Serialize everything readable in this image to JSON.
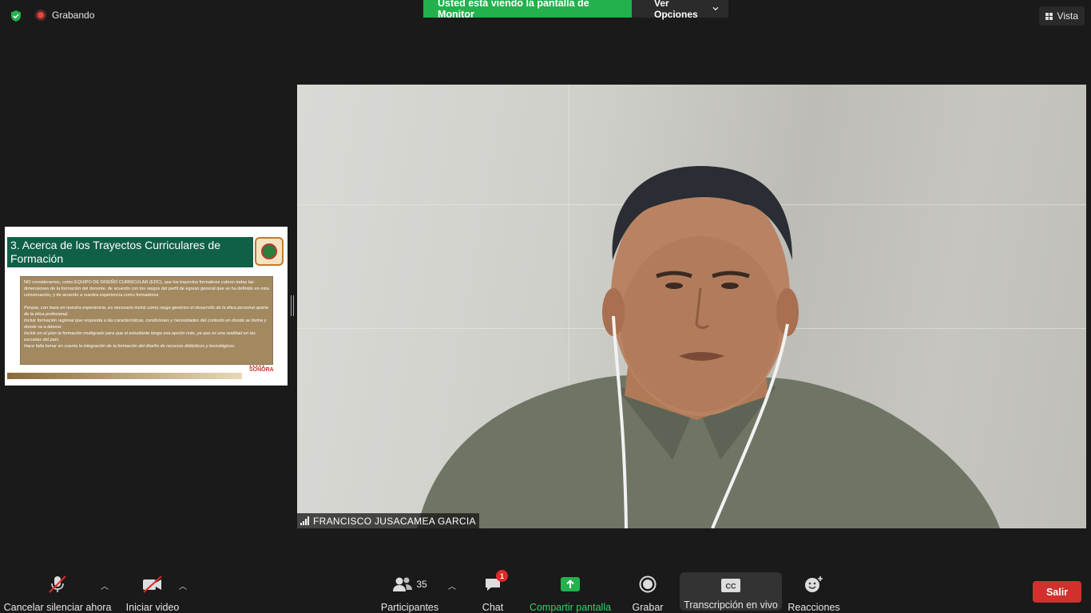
{
  "topbar": {
    "recording_label": "Grabando",
    "banner_text": "Usted está viendo la pantalla de Monitor",
    "options_label": "Ver Opciones",
    "view_label": "Vista"
  },
  "slide": {
    "title": "3. Acerca de los Trayectos Curriculares de Formación",
    "para1": "NO consideramos,  como EQUIPO DE DISEÑO CURRICULAR (EDC), que los trayectos formativos cubren todas las dimensiones de la formación del docente, de acuerdo con los rasgos del perfil de egreso general que se ha definido en esta conversación, y de acuerdo a nuestra experiencia como formadores",
    "para2": "Porque, con base en nuestra experiencia, es necesario incluir como rasgo genérico el desarrollo de la ética personal aparte de la ética profesional.",
    "para3": "Incluir formación regional que responda a las características, condiciones y necesidades del contexto en donde se forma y donde va a laborar.",
    "para4": "Incluir en el plan la formación multigrado para que el estudiante tenga esa opción más, ya que es una realidad en las escuelas del país.",
    "para5": "Hace falta tomar en cuenta la integración de la formación  del diseño de recursos didácticos y tecnológicos.",
    "brand": "SONORA"
  },
  "video": {
    "participant_name": "FRANCISCO JUSACAMEA GARCIA"
  },
  "toolbar": {
    "mute_label": "Cancelar silenciar ahora",
    "video_label": "Iniciar video",
    "participants_label": "Participantes",
    "participants_count": "35",
    "chat_label": "Chat",
    "chat_badge": "1",
    "share_label": "Compartir pantalla",
    "record_label": "Grabar",
    "transcription_label": "Transcripción en vivo",
    "cc_label": "CC",
    "reactions_label": "Reacciones",
    "leave_label": "Salir"
  },
  "colors": {
    "accent_green": "#23b14d",
    "leave_red": "#d0312d",
    "slide_title_bg": "#0f6047",
    "slide_box_bg": "#a38960"
  }
}
